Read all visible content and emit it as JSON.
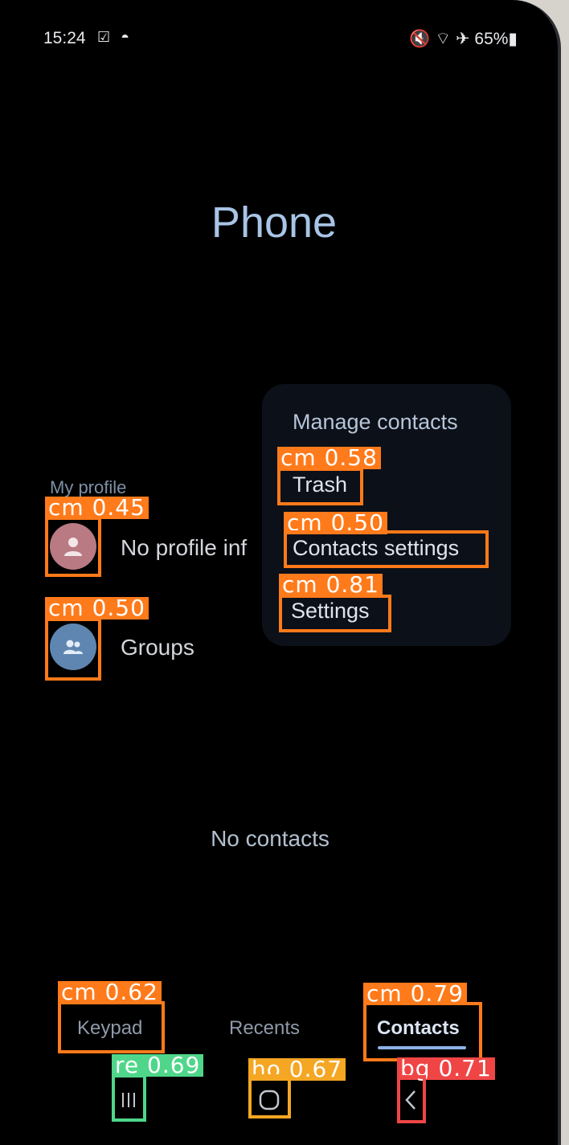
{
  "status_bar": {
    "time": "15:24",
    "left_icons": "☑ ◓",
    "right_icons": "🔇 ⌔ ✈",
    "battery": "65%▮"
  },
  "app": {
    "title": "Phone"
  },
  "profile": {
    "section_label": "My profile",
    "text": "No profile inf",
    "avatar_icon": "person-icon"
  },
  "groups": {
    "label": "Groups",
    "icon": "group-icon"
  },
  "manage_menu": {
    "title": "Manage contacts",
    "items": [
      "Trash",
      "Contacts settings",
      "Settings"
    ]
  },
  "empty_state": "No contacts",
  "tabs": [
    "Keypad",
    "Recents",
    "Contacts"
  ],
  "active_tab": "Contacts",
  "annotations": [
    "cm 0.58",
    "cm 0.50",
    "cm 0.81",
    "cm 0.45",
    "cm 0.50",
    "cm 0.62",
    "cm 0.79",
    "re 0.69",
    "ho 0.67",
    "bg 0.71"
  ],
  "colors": {
    "annotation_orange": "#ff7a1a",
    "annotation_green": "#4fd68a",
    "annotation_yellow": "#f5a623",
    "annotation_red": "#f04545",
    "accent_blue": "#a8c4e6"
  }
}
